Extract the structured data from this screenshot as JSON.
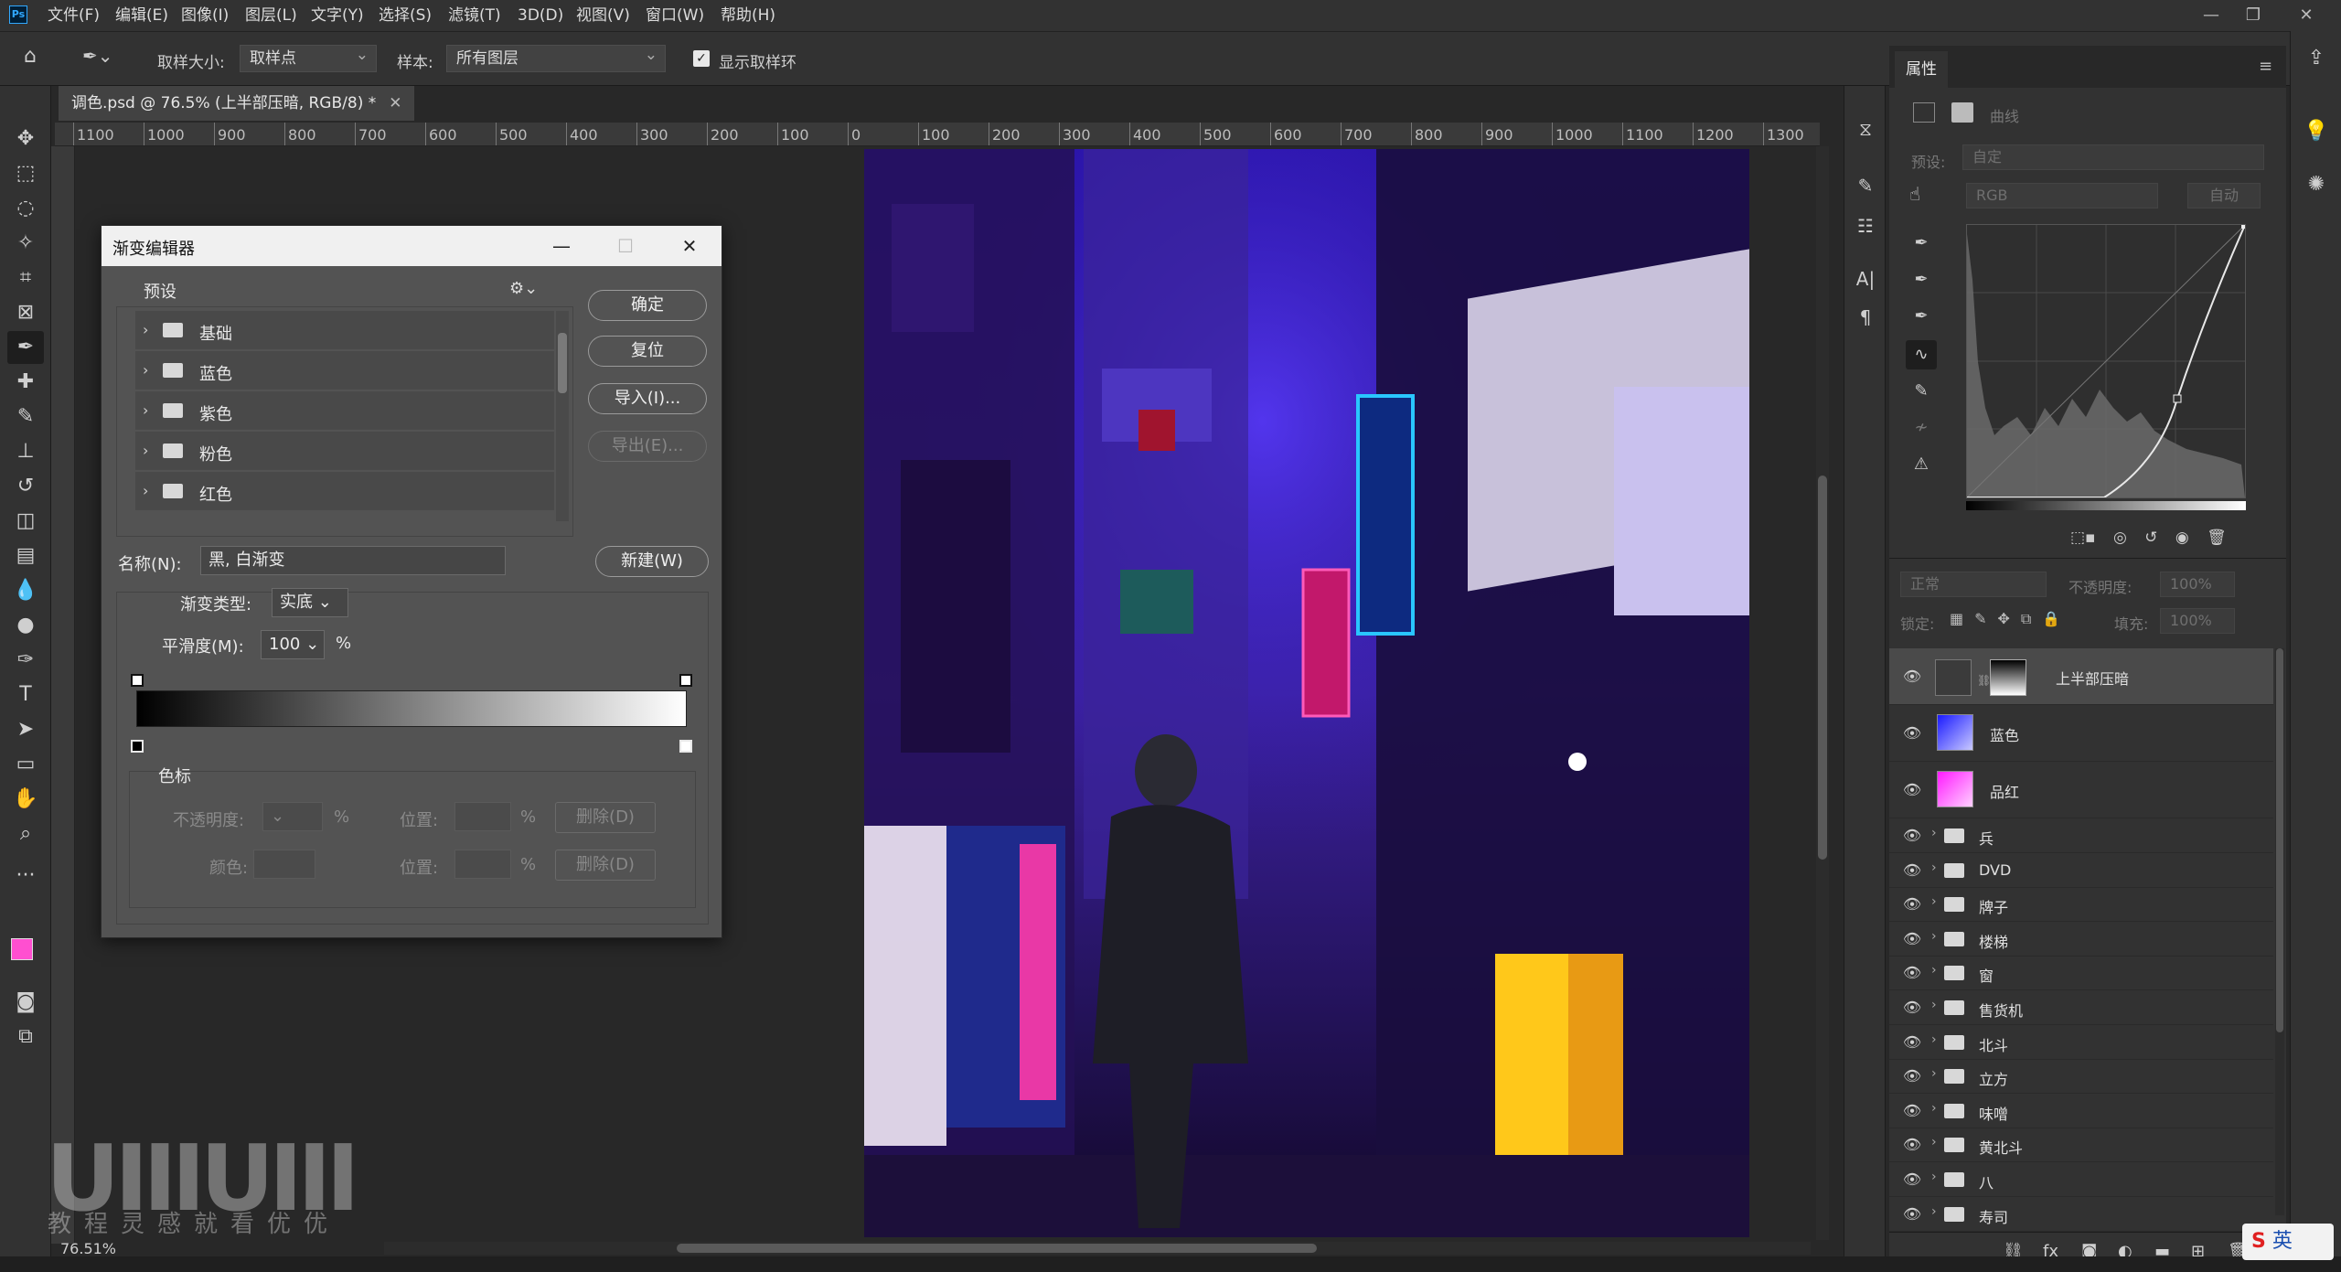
{
  "menu": {
    "items": [
      "文件(F)",
      "编辑(E)",
      "图像(I)",
      "图层(L)",
      "文字(Y)",
      "选择(S)",
      "滤镜(T)",
      "3D(D)",
      "视图(V)",
      "窗口(W)",
      "帮助(H)"
    ]
  },
  "options": {
    "sample_size_label": "取样大小:",
    "sample_size_value": "取样点",
    "sample_label": "样本:",
    "sample_value": "所有图层",
    "show_ring_label": "显示取样环"
  },
  "document": {
    "tab_title": "调色.psd @ 76.5% (上半部压暗, RGB/8) *",
    "zoom_readout": "76.51%"
  },
  "ruler": {
    "top_ticks": [
      "1100",
      "1000",
      "900",
      "800",
      "700",
      "600",
      "500",
      "400",
      "300",
      "200",
      "100",
      "0",
      "100",
      "200",
      "300",
      "400",
      "500",
      "600",
      "700",
      "800",
      "900",
      "1000",
      "1100",
      "1200",
      "1300"
    ]
  },
  "gradient_editor": {
    "title": "渐变编辑器",
    "presets_label": "预设",
    "presets": [
      "基础",
      "蓝色",
      "紫色",
      "粉色",
      "红色"
    ],
    "ok_button": "确定",
    "reset_button": "复位",
    "import_button": "导入(I)...",
    "export_button": "导出(E)...",
    "name_label": "名称(N):",
    "name_value": "黑, 白渐变",
    "new_button": "新建(W)",
    "type_label": "渐变类型:",
    "type_value": "实底",
    "smooth_label": "平滑度(M):",
    "smooth_value": "100",
    "percent": "%",
    "stops_label": "色标",
    "opacity_label": "不透明度:",
    "color_label": "颜色:",
    "location_label": "位置:",
    "delete_button": "删除(D)"
  },
  "properties": {
    "tab": "属性",
    "adj_name": "曲线",
    "preset_label": "预设:",
    "preset_value": "自定",
    "channel_value": "RGB",
    "auto_button": "自动"
  },
  "layers": {
    "blend_mode": "正常",
    "opacity_label": "不透明度:",
    "opacity_value": "100%",
    "lock_label": "锁定:",
    "fill_label": "填充:",
    "fill_value": "100%",
    "items": [
      {
        "name": "上半部压暗",
        "type": "adjustment"
      },
      {
        "name": "蓝色",
        "type": "fill"
      },
      {
        "name": "品红",
        "type": "fill"
      },
      {
        "name": "兵",
        "type": "group"
      },
      {
        "name": "DVD",
        "type": "group"
      },
      {
        "name": "牌子",
        "type": "group"
      },
      {
        "name": "楼梯",
        "type": "group"
      },
      {
        "name": "窗",
        "type": "group"
      },
      {
        "name": "售货机",
        "type": "group"
      },
      {
        "name": "北斗",
        "type": "group"
      },
      {
        "name": "立方",
        "type": "group"
      },
      {
        "name": "味噌",
        "type": "group"
      },
      {
        "name": "黄北斗",
        "type": "group"
      },
      {
        "name": "八",
        "type": "group"
      },
      {
        "name": "寿司",
        "type": "group"
      }
    ]
  },
  "watermark": {
    "logo": "UIIIUIII",
    "sub": "教程灵感就看优优"
  },
  "ime": {
    "label": "英"
  }
}
